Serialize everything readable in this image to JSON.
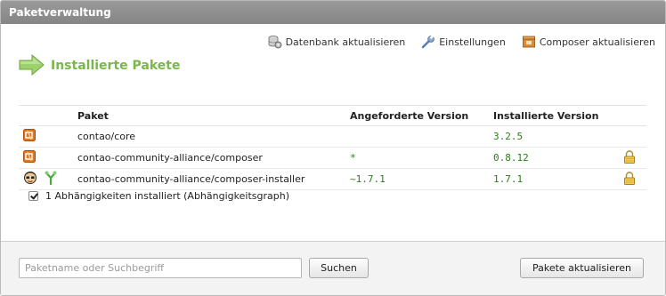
{
  "window": {
    "title": "Paketverwaltung"
  },
  "toolbar": {
    "items": [
      {
        "label": "Datenbank aktualisieren",
        "icon": "database-gear-icon"
      },
      {
        "label": "Einstellungen",
        "icon": "wrench-icon"
      },
      {
        "label": "Composer aktualisieren",
        "icon": "composer-box-icon"
      }
    ]
  },
  "heading": {
    "text": "Installierte Pakete",
    "icon": "green-arrow-icon"
  },
  "table": {
    "headers": {
      "package": "Paket",
      "requested": "Angeforderte Version",
      "installed": "Installierte Version"
    },
    "rows": [
      {
        "name": "contao/core",
        "requested": "",
        "installed": "3.2.5",
        "locked": false,
        "icons": [
          "package-icon"
        ]
      },
      {
        "name": "contao-community-alliance/composer",
        "requested": "*",
        "installed": "0.8.12",
        "locked": true,
        "icons": [
          "package-icon"
        ]
      },
      {
        "name": "contao-community-alliance/composer-installer",
        "requested": "~1.7.1",
        "installed": "1.7.1",
        "locked": true,
        "icons": [
          "mascot-icon",
          "dependency-fork-icon"
        ]
      }
    ]
  },
  "dependencies": {
    "text": "1 Abhängigkeiten installiert (Abhängigkeitsgraph)",
    "checked": true
  },
  "footer": {
    "search_placeholder": "Paketname oder Suchbegriff",
    "search_button": "Suchen",
    "update_button": "Pakete aktualisieren"
  },
  "colors": {
    "accent_green": "#7ab648",
    "version_green": "#2c7c18",
    "titlebar": "#8f8f8f"
  }
}
